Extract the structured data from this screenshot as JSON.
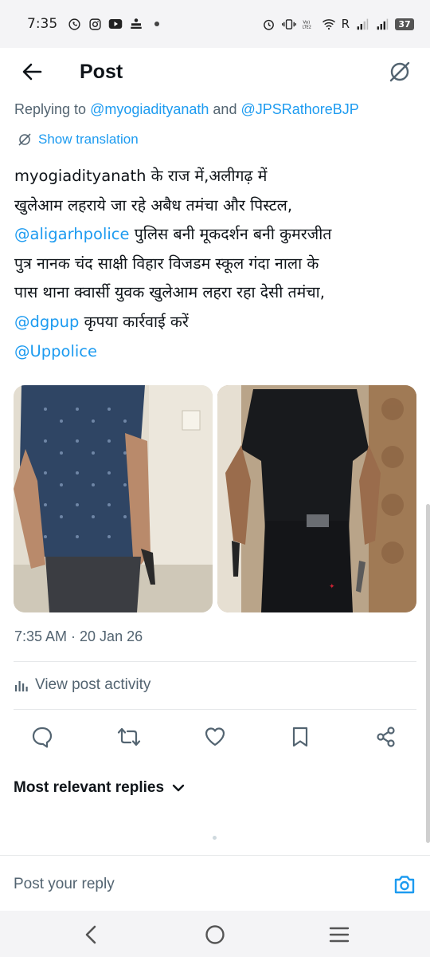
{
  "status_bar": {
    "time": "7:35",
    "carrier_indicator": "R",
    "battery": "37",
    "icons": [
      "whatsapp-icon",
      "instagram-icon",
      "youtube-icon",
      "app-notification-icon",
      "dot-icon",
      "alarm-icon",
      "vibrate-icon",
      "volte-icon",
      "wifi-icon",
      "signal-icon",
      "signal-icon",
      "battery-icon"
    ]
  },
  "header": {
    "title": "Post"
  },
  "post": {
    "replying_label": "Replying to ",
    "reply_mention_1": "@myogiadityanath",
    "reply_and": " and ",
    "reply_mention_2": "@JPSRathoreBJP",
    "show_translation": "Show translation",
    "lines": {
      "l1": "myogiadityanath के राज में,अलीगढ़ में",
      "l2": "खुलेआम लहराये जा रहे अबैध तमंचा और पिस्टल,",
      "l3_mention": "@aligarhpolice",
      "l3_text": " पुलिस बनी मूकदर्शन बनी कुमरजीत",
      "l4": "पुत्र नानक चंद साक्षी विहार विजडम स्कूल गंदा नाला के",
      "l5": "पास थाना क्वार्सी युवक खुलेआम लहरा रहा देसी तमंचा,",
      "l6_mention": "@dgpup",
      "l6_text": " कृपया कार्रवाई करें",
      "l7_mention": "@Uppolice"
    },
    "timestamp": "7:35 AM · 20 Jan 26",
    "view_activity": "View post activity"
  },
  "replies": {
    "sort_label": "Most relevant replies"
  },
  "reply_bar": {
    "placeholder": "Post your reply"
  },
  "colors": {
    "accent": "#1d9bf0",
    "text_primary": "#0f1419",
    "text_secondary": "#536471",
    "divider": "#e6e8ea",
    "system_bar": "#f4f4f6"
  }
}
